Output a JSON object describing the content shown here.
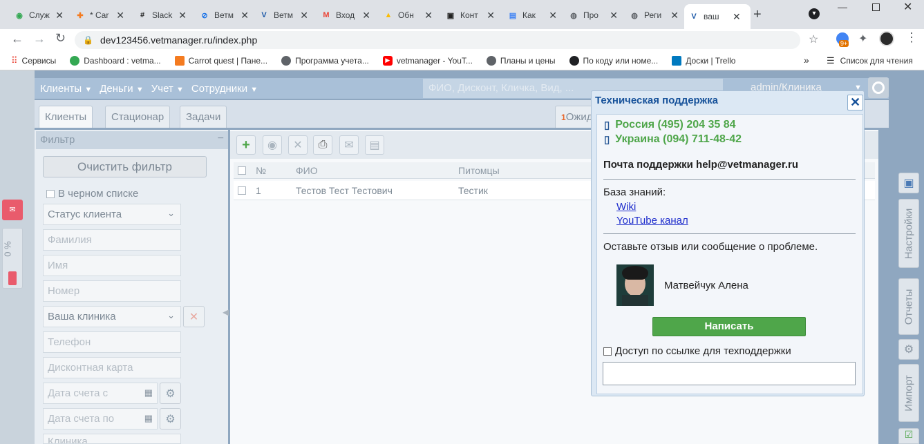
{
  "browser": {
    "tabs": [
      {
        "title": "Служ",
        "favicon": "green-circle",
        "color": "#34a853"
      },
      {
        "title": "* Car",
        "favicon": "carrot",
        "color": "#f47b20"
      },
      {
        "title": "Slack",
        "favicon": "slack",
        "color": "#222222"
      },
      {
        "title": "Ветм",
        "favicon": "vetmanager-link",
        "color": "#1a73e8"
      },
      {
        "title": "Ветм",
        "favicon": "vetmanager-v",
        "color": "#1e5aa8"
      },
      {
        "title": "Вход",
        "favicon": "gmail",
        "color": "#ea4335"
      },
      {
        "title": "Обн",
        "favicon": "drive",
        "color": "#fbbc04"
      },
      {
        "title": "Конт",
        "favicon": "clapper",
        "color": "#222222"
      },
      {
        "title": "Как",
        "favicon": "docs",
        "color": "#4285f4"
      },
      {
        "title": "Про",
        "favicon": "globe",
        "color": "#5f6368"
      },
      {
        "title": "Реги",
        "favicon": "globe",
        "color": "#5f6368"
      },
      {
        "title": "ваш",
        "favicon": "vetmanager-v",
        "color": "#1e5aa8",
        "active": true
      }
    ],
    "url": "dev123456.vetmanager.ru/index.php",
    "extension_badge": "9+",
    "bookmarks": [
      {
        "label": "Сервисы"
      },
      {
        "label": "Dashboard : vetma..."
      },
      {
        "label": "Carrot quest | Пане..."
      },
      {
        "label": "Программа учета..."
      },
      {
        "label": "vetmanager - YouT..."
      },
      {
        "label": "Планы и цены"
      },
      {
        "label": "По коду или номе..."
      },
      {
        "label": "Доски | Trello"
      }
    ],
    "reading_list": "Список для чтения",
    "more": "»"
  },
  "app": {
    "menu": [
      "Клиенты",
      "Деньги",
      "Учет",
      "Сотрудники"
    ],
    "search_placeholder": "ФИО, Дисконт, Кличка, Вид, ...",
    "user": "admin/Клиника",
    "tabs": [
      "Клиенты",
      "Стационар",
      "Задачи"
    ],
    "waiting_count": "1",
    "waiting_label": "Ожид"
  },
  "filter": {
    "title": "Фильтр",
    "collapse": "−",
    "clear": "Очистить фильтр",
    "blacklist": "В черном списке",
    "fields": [
      "Статус клиента",
      "Фамилия",
      "Имя",
      "Номер",
      "Ваша клиника",
      "Телефон",
      "Дисконтная карта",
      "Дата счета с",
      "Дата счета по",
      "Клиника"
    ]
  },
  "grid": {
    "columns": [
      "№",
      "ФИО",
      "Питомцы"
    ],
    "rows": [
      {
        "num": "1",
        "name": "Тестов Тест Тестович",
        "pets": "Тестик"
      }
    ]
  },
  "right_tabs": [
    "Настройки",
    "Отчеты",
    "Импорт"
  ],
  "left_side": {
    "percent": "0 %"
  },
  "support": {
    "title": "Техническая поддержка",
    "close": "✕",
    "phone_ru": "Россия (495) 204 35 84",
    "phone_ua": "Украина (094) 711-48-42",
    "email": "Почта поддержки help@vetmanager.ru",
    "kb_label": "База знаний:",
    "wiki": "Wiki",
    "youtube": "YouTube канал",
    "feedback": "Оставьте отзыв или сообщение о проблеме.",
    "agent": "Матвейчук Алена",
    "write": "Написать",
    "access": "Доступ по ссылке для техподдержки"
  }
}
